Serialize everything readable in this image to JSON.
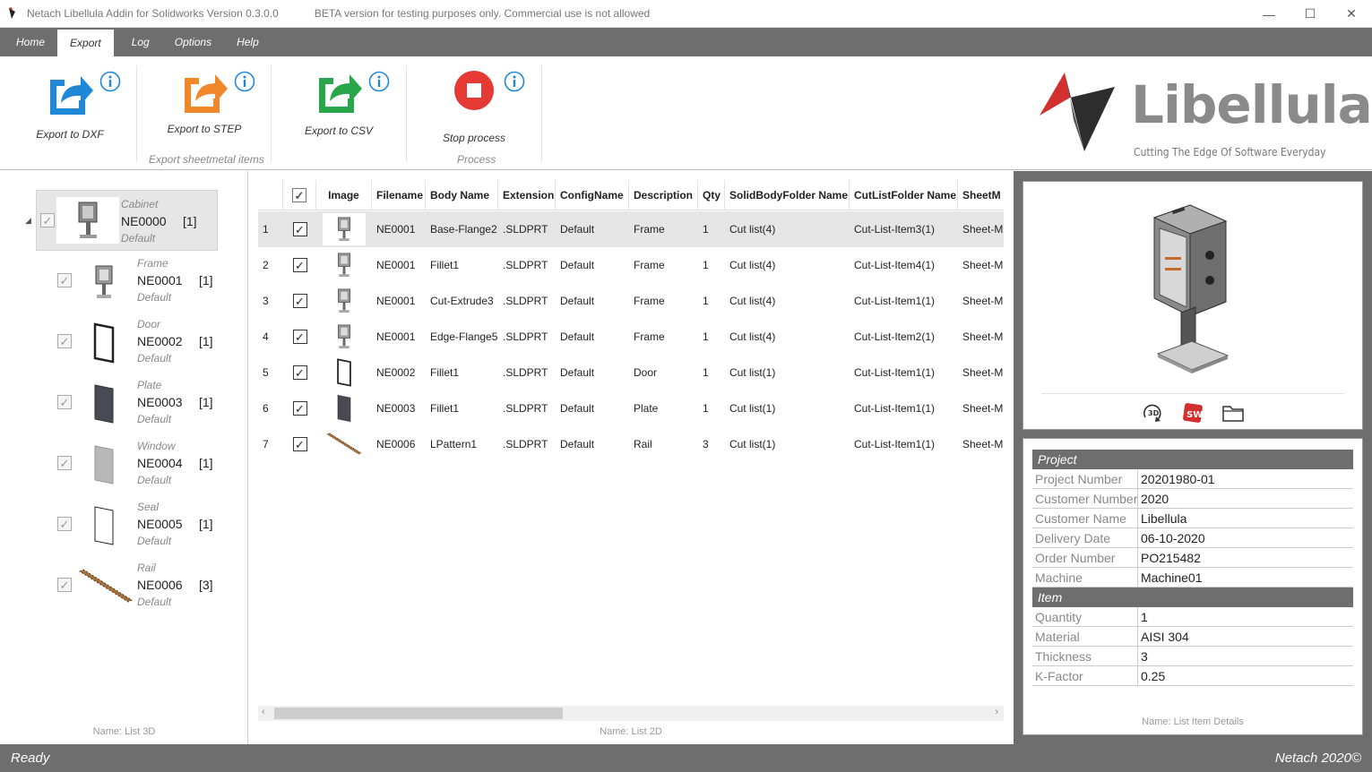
{
  "window": {
    "title": "Netach Libellula Addin for Solidworks Version 0.3.0.0",
    "beta_notice": "BETA version for testing purposes only. Commercial use is not allowed",
    "minimize": "—",
    "maximize": "☐",
    "close": "✕"
  },
  "menu": {
    "tabs": [
      {
        "label": "Home"
      },
      {
        "label": "Export"
      },
      {
        "label": "Log"
      },
      {
        "label": "Options"
      },
      {
        "label": "Help"
      }
    ],
    "active": "Export"
  },
  "ribbon": {
    "export_dxf": "Export to DXF",
    "export_step": "Export to STEP",
    "export_csv": "Export to CSV",
    "stop_process": "Stop process",
    "group_sheetmetal": "Export sheetmetal items",
    "group_process": "Process",
    "colors": {
      "dxf": "#1e88d6",
      "step": "#f0882a",
      "csv": "#27a64a",
      "stop": "#e53935"
    }
  },
  "logo": {
    "text": "Libellula",
    "tagline": "Cutting The Edge Of Software Everyday"
  },
  "tree": {
    "root": {
      "type": "Cabinet",
      "code": "NE0000",
      "qty": "[1]",
      "config": "Default"
    },
    "items": [
      {
        "type": "Frame",
        "code": "NE0001",
        "qty": "[1]",
        "config": "Default",
        "icon": "frame-icon"
      },
      {
        "type": "Door",
        "code": "NE0002",
        "qty": "[1]",
        "config": "Default",
        "icon": "door-icon"
      },
      {
        "type": "Plate",
        "code": "NE0003",
        "qty": "[1]",
        "config": "Default",
        "icon": "plate-icon"
      },
      {
        "type": "Window",
        "code": "NE0004",
        "qty": "[1]",
        "config": "Default",
        "icon": "window-icon"
      },
      {
        "type": "Seal",
        "code": "NE0005",
        "qty": "[1]",
        "config": "Default",
        "icon": "seal-icon"
      },
      {
        "type": "Rail",
        "code": "NE0006",
        "qty": "[3]",
        "config": "Default",
        "icon": "rail-icon"
      }
    ],
    "panel_name": "Name: List 3D"
  },
  "grid": {
    "columns": [
      "",
      "",
      "Image",
      "Filename",
      "Body Name",
      "Extension",
      "ConfigName",
      "Description",
      "Qty",
      "SolidBodyFolder Name",
      "CutListFolder Name",
      "SheetM"
    ],
    "rows": [
      {
        "n": "1",
        "file": "NE0001",
        "body": "Base-Flange2",
        "ext": ".SLDPRT",
        "cfg": "Default",
        "desc": "Frame",
        "qty": "1",
        "sbf": "Cut list(4)",
        "clf": "Cut-List-Item3(1)",
        "sm": "Sheet-M",
        "img": "frame-icon"
      },
      {
        "n": "2",
        "file": "NE0001",
        "body": "Fillet1",
        "ext": ".SLDPRT",
        "cfg": "Default",
        "desc": "Frame",
        "qty": "1",
        "sbf": "Cut list(4)",
        "clf": "Cut-List-Item4(1)",
        "sm": "Sheet-M",
        "img": "frame-icon"
      },
      {
        "n": "3",
        "file": "NE0001",
        "body": "Cut-Extrude3",
        "ext": ".SLDPRT",
        "cfg": "Default",
        "desc": "Frame",
        "qty": "1",
        "sbf": "Cut list(4)",
        "clf": "Cut-List-Item1(1)",
        "sm": "Sheet-M",
        "img": "frame-icon"
      },
      {
        "n": "4",
        "file": "NE0001",
        "body": "Edge-Flange5",
        "ext": ".SLDPRT",
        "cfg": "Default",
        "desc": "Frame",
        "qty": "1",
        "sbf": "Cut list(4)",
        "clf": "Cut-List-Item2(1)",
        "sm": "Sheet-M",
        "img": "frame-icon"
      },
      {
        "n": "5",
        "file": "NE0002",
        "body": "Fillet1",
        "ext": ".SLDPRT",
        "cfg": "Default",
        "desc": "Door",
        "qty": "1",
        "sbf": "Cut list(1)",
        "clf": "Cut-List-Item1(1)",
        "sm": "Sheet-M",
        "img": "door-icon"
      },
      {
        "n": "6",
        "file": "NE0003",
        "body": "Fillet1",
        "ext": ".SLDPRT",
        "cfg": "Default",
        "desc": "Plate",
        "qty": "1",
        "sbf": "Cut list(1)",
        "clf": "Cut-List-Item1(1)",
        "sm": "Sheet-M",
        "img": "plate-icon"
      },
      {
        "n": "7",
        "file": "NE0006",
        "body": "LPattern1",
        "ext": ".SLDPRT",
        "cfg": "Default",
        "desc": "Rail",
        "qty": "3",
        "sbf": "Cut list(1)",
        "clf": "Cut-List-Item1(1)",
        "sm": "Sheet-M",
        "img": "rail-icon"
      }
    ],
    "panel_name": "Name: List 2D"
  },
  "details": {
    "project_header": "Project",
    "project": [
      {
        "key": "Project Number",
        "value": "20201980-01"
      },
      {
        "key": "Customer Number",
        "value": "2020"
      },
      {
        "key": "Customer Name",
        "value": "Libellula"
      },
      {
        "key": "Delivery Date",
        "value": "06-10-2020"
      },
      {
        "key": "Order Number",
        "value": "PO215482"
      },
      {
        "key": "Machine",
        "value": "Machine01"
      }
    ],
    "item_header": "Item",
    "item": [
      {
        "key": "Quantity",
        "value": "1"
      },
      {
        "key": "Material",
        "value": "AISI 304"
      },
      {
        "key": "Thickness",
        "value": "3"
      },
      {
        "key": "K-Factor",
        "value": "0.25"
      }
    ],
    "panel_name": "Name: List Item Details"
  },
  "status": {
    "left": "Ready",
    "right": "Netach 2020©"
  }
}
